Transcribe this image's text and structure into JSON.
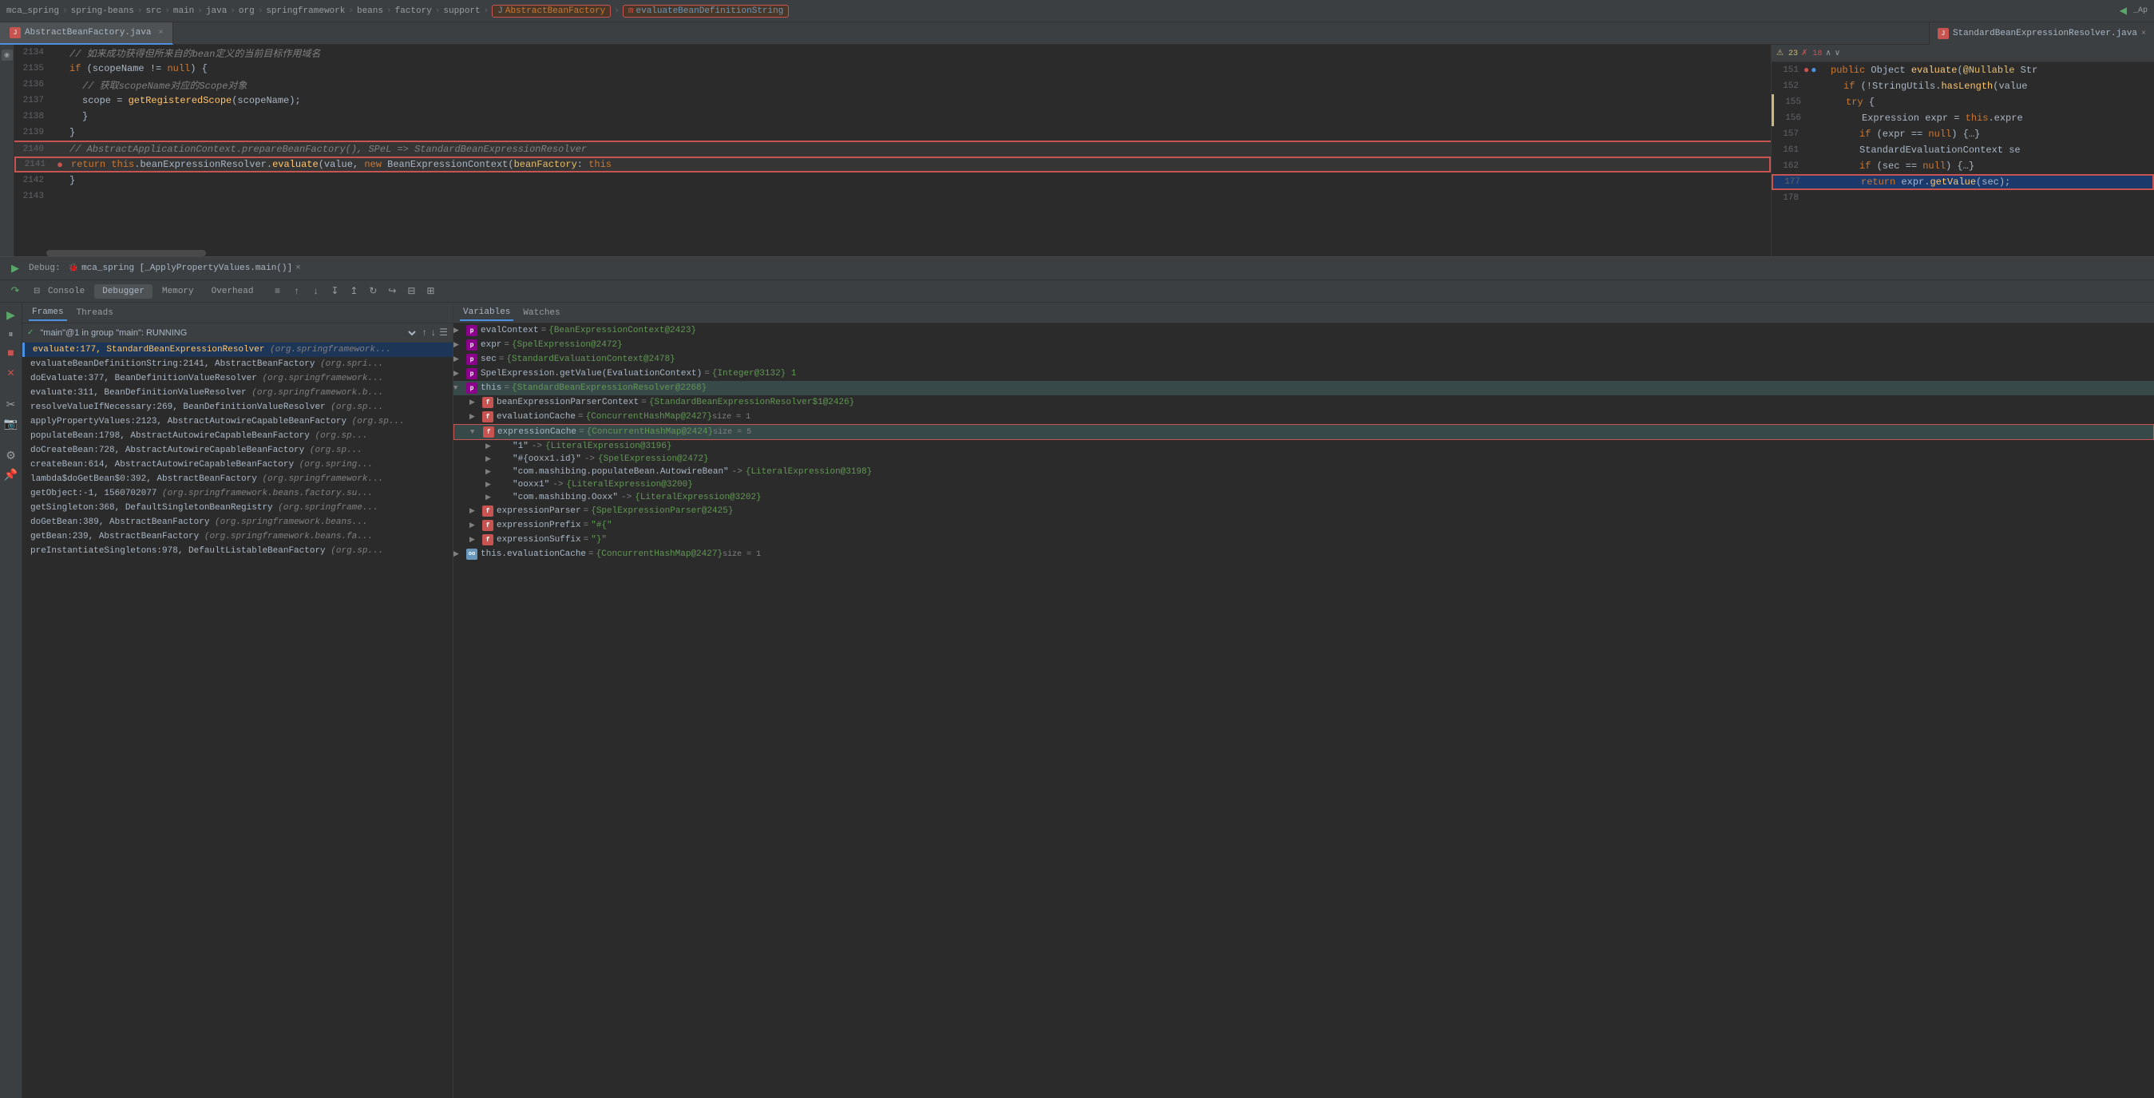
{
  "breadcrumb": {
    "items": [
      "mca_spring",
      "spring-beans",
      "src",
      "main",
      "java",
      "org",
      "springframework",
      "beans",
      "factory",
      "support"
    ],
    "highlighted": [
      {
        "label": "AbstractBeanFactory",
        "type": "class"
      },
      {
        "label": "evaluateBeanDefinitionString",
        "type": "method"
      }
    ]
  },
  "tabs_left": [
    {
      "label": "AbstractBeanFactory.java",
      "active": true,
      "icon": "J"
    },
    {
      "label": "StandardBeanExpressionResolver.java",
      "active": false,
      "icon": "J"
    }
  ],
  "code_left": {
    "lines": [
      {
        "num": "2134",
        "content": "// 如来成功获得但所来自的bean定义的当前目标作用域名",
        "type": "comment",
        "gutter": ""
      },
      {
        "num": "2135",
        "content": "if (scopeName != null) {",
        "type": "code",
        "gutter": ""
      },
      {
        "num": "2136",
        "content": "    // 获取scopeName对应的Scope对象",
        "type": "comment",
        "gutter": ""
      },
      {
        "num": "2137",
        "content": "    scope = getRegisteredScope(scopeName);",
        "type": "code",
        "gutter": ""
      },
      {
        "num": "2138",
        "content": "}",
        "type": "code",
        "gutter": ""
      },
      {
        "num": "2139",
        "content": "}",
        "type": "code",
        "gutter": ""
      },
      {
        "num": "2140",
        "content": "// AbstractApplicationContext.prepareBeanFactory(), SPeL => StandardBeanExpressionResolver",
        "type": "comment-highlight",
        "gutter": ""
      },
      {
        "num": "2141",
        "content": "return this.beanExpressionResolver.evaluate(value, new BeanExpressionContext(beanFactory: this",
        "type": "code-highlight",
        "gutter": "breakpoint"
      },
      {
        "num": "2142",
        "content": "}",
        "type": "code",
        "gutter": ""
      },
      {
        "num": "2143",
        "content": "",
        "type": "code",
        "gutter": ""
      }
    ]
  },
  "code_right": {
    "warnings": "23",
    "errors": "18",
    "lines": [
      {
        "num": "151",
        "content": "public Object evaluate(@Nullable Str",
        "gutters": [
          "red-dot",
          "blue-dot"
        ]
      },
      {
        "num": "152",
        "content": "    if (!StringUtils.hasLength(value",
        "gutters": []
      },
      {
        "num": "155",
        "content": "    try {",
        "gutters": [
          "yellow-bar"
        ]
      },
      {
        "num": "156",
        "content": "        Expression expr = this.expre",
        "gutters": [
          "yellow-bar"
        ]
      },
      {
        "num": "157",
        "content": "        if (expr == null) {...}",
        "gutters": []
      },
      {
        "num": "161",
        "content": "        StandardEvaluationContext se",
        "gutters": []
      },
      {
        "num": "162",
        "content": "        if (sec == null) {...}",
        "gutters": []
      },
      {
        "num": "177",
        "content": "        return expr.getValue(sec);",
        "gutters": [
          "highlighted"
        ]
      },
      {
        "num": "178",
        "content": "",
        "gutters": []
      }
    ]
  },
  "debug_bar": {
    "label": "Debug:",
    "session": "mca_spring [_ApplyPropertyValues.main()]"
  },
  "debug_tabs": {
    "tabs": [
      "Console",
      "Debugger",
      "Memory",
      "Overhead"
    ],
    "active": "Debugger",
    "icons": [
      "≡",
      "↑",
      "↓",
      "↧",
      "↥",
      "↻",
      "↪",
      "⊟",
      "⊞"
    ]
  },
  "frames": {
    "tabs": [
      "Frames",
      "Threads"
    ],
    "active": "Frames",
    "thread": "\"main\"@1 in group \"main\": RUNNING",
    "items": [
      {
        "name": "evaluate:177",
        "class": "StandardBeanExpressionResolver",
        "pkg": "(org.springframework...",
        "active": true
      },
      {
        "name": "evaluateBeanDefinitionString:2141",
        "class": "AbstractBeanFactory",
        "pkg": "(org.spri...",
        "active": false
      },
      {
        "name": "doEvaluate:377",
        "class": "BeanDefinitionValueResolver",
        "pkg": "(org.springframework...",
        "active": false
      },
      {
        "name": "evaluate:311",
        "class": "BeanDefinitionValueResolver",
        "pkg": "(org.springframework.b...",
        "active": false
      },
      {
        "name": "resolveValueIfNecessary:269",
        "class": "BeanDefinitionValueResolver",
        "pkg": "(org.sp...",
        "active": false
      },
      {
        "name": "applyPropertyValues:2123",
        "class": "AbstractAutowireCapableBeanFactory",
        "pkg": "(org.sp...",
        "active": false
      },
      {
        "name": "populateBean:1798",
        "class": "AbstractAutowireCapableBeanFactory",
        "pkg": "(org.sp...",
        "active": false
      },
      {
        "name": "doCreateBean:728",
        "class": "AbstractAutowireCapableBeanFactory",
        "pkg": "(org.sp...",
        "active": false
      },
      {
        "name": "createBean:614",
        "class": "AbstractAutowireCapableBeanFactory",
        "pkg": "(org.spring...",
        "active": false
      },
      {
        "name": "lambda$doGetBean$0:392",
        "class": "AbstractBeanFactory",
        "pkg": "(org.springframework...",
        "active": false
      },
      {
        "name": "getObject:-1",
        "class": "1560702077",
        "pkg": "(org.springframework.beans.factory.su...",
        "active": false
      },
      {
        "name": "getSingleton:368",
        "class": "DefaultSingletonBeanRegistry",
        "pkg": "(org.springframe...",
        "active": false
      },
      {
        "name": "doGetBean:389",
        "class": "AbstractBeanFactory",
        "pkg": "(org.springframework.beans...",
        "active": false
      },
      {
        "name": "getBean:239",
        "class": "AbstractBeanFactory",
        "pkg": "(org.springframework.beans.fa...",
        "active": false
      },
      {
        "name": "preInstantiateSingletons:978",
        "class": "DefaultListableBeanFactory",
        "pkg": "(org.sp...",
        "active": false
      }
    ]
  },
  "variables": {
    "tabs": [
      "Variables",
      "Watches"
    ],
    "active": "Variables",
    "items": [
      {
        "icon": "p",
        "toggle": "▶",
        "name": "evalContext",
        "value": "{BeanExpressionContext@2423}",
        "extra": "",
        "indent": 0
      },
      {
        "icon": "p",
        "toggle": "▶",
        "name": "expr",
        "value": "{SpelExpression@2472}",
        "extra": "",
        "indent": 0
      },
      {
        "icon": "p",
        "toggle": "▶",
        "name": "sec",
        "value": "{StandardEvaluationContext@2478}",
        "extra": "",
        "indent": 0
      },
      {
        "icon": "p",
        "toggle": "▶",
        "name": "SpelExpression.getValue(EvaluationContext)",
        "value": "= {Integer@3132} 1",
        "extra": "",
        "indent": 0
      },
      {
        "icon": "p",
        "toggle": "▼",
        "name": "this",
        "value": "= {StandardBeanExpressionResolver@2268}",
        "extra": "",
        "indent": 0,
        "highlighted": true
      },
      {
        "icon": "f",
        "toggle": "▶",
        "name": "beanExpressionParserContext",
        "value": "= {StandardBeanExpressionResolver$1@2426}",
        "extra": "",
        "indent": 1
      },
      {
        "icon": "f",
        "toggle": "▶",
        "name": "evaluationCache",
        "value": "= {ConcurrentHashMap@2427}",
        "extra": "size = 1",
        "indent": 1
      },
      {
        "icon": "f",
        "toggle": "▼",
        "name": "expressionCache",
        "value": "= {ConcurrentHashMap@2424}",
        "extra": "size = 5",
        "indent": 1,
        "highlighted": true
      },
      {
        "icon": "",
        "toggle": "▶",
        "name": "\"1\"",
        "value": "-> {LiteralExpression@3196}",
        "extra": "",
        "indent": 2
      },
      {
        "icon": "",
        "toggle": "▶",
        "name": "\"#{ooxx1.id}\"",
        "value": "-> {SpelExpression@2472}",
        "extra": "",
        "indent": 2
      },
      {
        "icon": "",
        "toggle": "▶",
        "name": "\"com.mashibing.populateBean.AutowireBean\"",
        "value": "-> {LiteralExpression@3198}",
        "extra": "",
        "indent": 2
      },
      {
        "icon": "",
        "toggle": "▶",
        "name": "\"ooxx1\"",
        "value": "-> {LiteralExpression@3200}",
        "extra": "",
        "indent": 2
      },
      {
        "icon": "",
        "toggle": "▶",
        "name": "\"com.mashibing.Ooxx\"",
        "value": "-> {LiteralExpression@3202}",
        "extra": "",
        "indent": 2
      },
      {
        "icon": "f",
        "toggle": "▶",
        "name": "expressionParser",
        "value": "= {SpelExpressionParser@2425}",
        "extra": "",
        "indent": 1
      },
      {
        "icon": "f",
        "toggle": "▶",
        "name": "expressionPrefix",
        "value": "= \"#{\"",
        "extra": "",
        "indent": 1
      },
      {
        "icon": "f",
        "toggle": "▶",
        "name": "expressionSuffix",
        "value": "= \"}\"",
        "extra": "",
        "indent": 1
      },
      {
        "icon": "oo",
        "toggle": "▶",
        "name": "this.evaluationCache",
        "value": "= {ConcurrentHashMap@2427}",
        "extra": "size = 1",
        "indent": 0
      }
    ]
  },
  "left_sidebar": {
    "icons": [
      "▶",
      "⏸",
      "⏹",
      "✕",
      "⟳",
      "✏",
      "⊙",
      "⚙",
      "📌"
    ]
  }
}
